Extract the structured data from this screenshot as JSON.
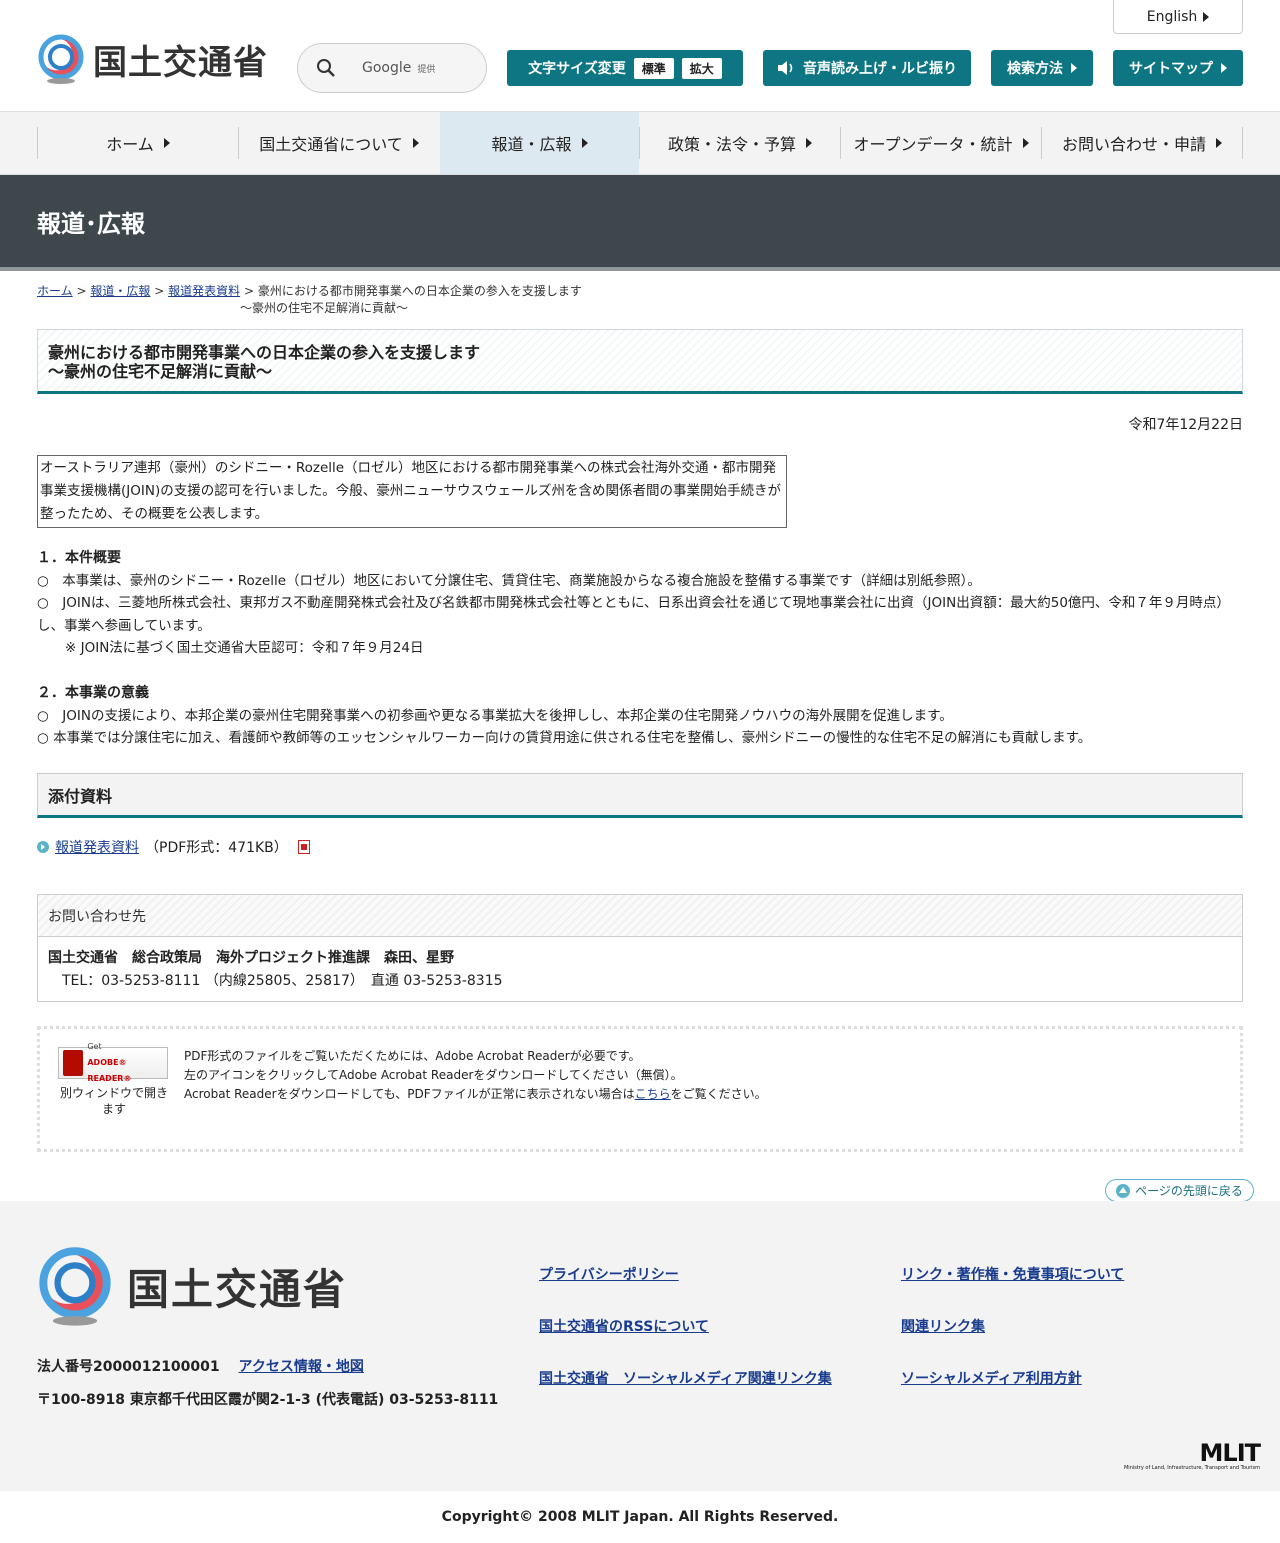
{
  "header": {
    "site_name": "国土交通省",
    "english_label": "English",
    "search_label": "Google",
    "search_sub": "提供",
    "font_size_label": "文字サイズ変更",
    "font_standard": "標準",
    "font_large": "拡大",
    "voice_label": "音声読み上げ・ルビ振り",
    "search_method_label": "検索方法",
    "sitemap_label": "サイトマップ"
  },
  "nav": {
    "items": [
      {
        "label": "ホーム"
      },
      {
        "label": "国土交通省について"
      },
      {
        "label": "報道・広報"
      },
      {
        "label": "政策・法令・予算"
      },
      {
        "label": "オープンデータ・統計"
      },
      {
        "label": "お問い合わせ・申請"
      }
    ]
  },
  "band_title": "報道･広報",
  "breadcrumb": {
    "home": "ホーム",
    "press": "報道・広報",
    "releases": "報道発表資料",
    "current_line1": "豪州における都市開発事業への日本企業の参入を支援します",
    "current_line2": "～豪州の住宅不足解消に貢献～",
    "sep": ">"
  },
  "article": {
    "title_line1": "豪州における都市開発事業への日本企業の参入を支援します",
    "title_line2": "～豪州の住宅不足解消に貢献～",
    "date": "令和7年12月22日",
    "intro": "オーストラリア連邦（豪州）のシドニー・Rozelle（ロゼル）地区における都市開発事業への株式会社海外交通・都市開発事業支援機構(JOIN)の支援の認可を行いました。今般、豪州ニューサウスウェールズ州を含め関係者間の事業開始手続きが整ったため、その概要を公表します。",
    "s1_title": "１．本件概要",
    "s1_p1": "○　本事業は、豪州のシドニー・Rozelle（ロゼル）地区において分譲住宅、賃貸住宅、商業施設からなる複合施設を整備する事業です（詳細は別紙参照）。",
    "s1_p2": "○　JOINは、三菱地所株式会社、東邦ガス不動産開発株式会社及び名鉄都市開発株式会社等とともに、日系出資会社を通じて現地事業会社に出資（JOIN出資額：最大約50億円、令和７年９月時点）し、事業へ参画しています。",
    "s1_note": "※ JOIN法に基づく国土交通省大臣認可：令和７年９月24日",
    "s2_title": "２．本事業の意義",
    "s2_p1": "○　JOINの支援により、本邦企業の豪州住宅開発事業への初参画や更なる事業拡大を後押しし、本邦企業の住宅開発ノウハウの海外展開を促進します。",
    "s2_p2": "○ 本事業では分譲住宅に加え、看護師や教師等のエッセンシャルワーカー向けの賃貸用途に供される住宅を整備し、豪州シドニーの慢性的な住宅不足の解消にも貢献します。"
  },
  "attachments": {
    "heading": "添付資料",
    "link_label": "報道発表資料",
    "link_meta": "（PDF形式：471KB）"
  },
  "contact": {
    "heading": "お問い合わせ先",
    "name": "国土交通省　総合政策局　海外プロジェクト推進課　森田、星野",
    "tel": "TEL：03-5253-8111 （内線25805、25817）　直通 03-5253-8315"
  },
  "adobe": {
    "badge_get": "Get",
    "badge_name": "ADOBE® READER®",
    "badge_caption": "別ウィンドウで開きます",
    "line1": "PDF形式のファイルをご覧いただくためには、Adobe Acrobat Readerが必要です。",
    "line2": "左のアイコンをクリックしてAdobe Acrobat Readerをダウンロードしてください（無償）。",
    "line3_pre": "Acrobat Readerをダウンロードしても、PDFファイルが正常に表示されない場合は",
    "line3_link": "こちら",
    "line3_post": "をご覧ください。"
  },
  "back_to_top": "ページの先頭に戻る",
  "footer": {
    "site_name": "国土交通省",
    "corp_number": "法人番号2000012100001",
    "access_link": "アクセス情報・地図",
    "address": "〒100-8918 東京都千代田区霞が関2-1-3 (代表電話) 03-5253-8111",
    "links": [
      "プライバシーポリシー",
      "リンク・著作権・免責事項について",
      "国土交通省のRSSについて",
      "関連リンク集",
      "国土交通省　ソーシャルメディア関連リンク集",
      "ソーシャルメディア利用方針"
    ],
    "mlit": "MLIT",
    "mlit_sub": "Ministry of Land, Infrastructure, Transport and Tourism",
    "copyright": "Copyright© 2008 MLIT Japan. All Rights Reserved."
  },
  "colors": {
    "accent": "#0e7682",
    "band": "#3d474c",
    "link": "#1a3c8f"
  }
}
